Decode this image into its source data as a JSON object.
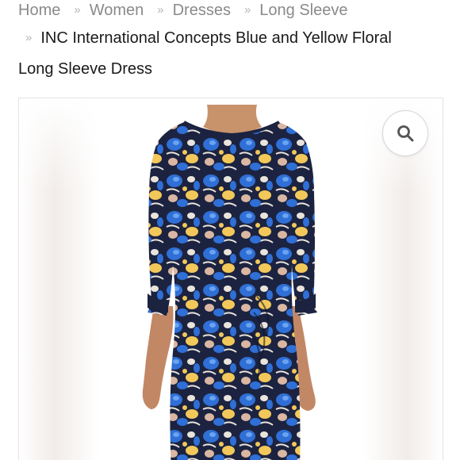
{
  "breadcrumb": {
    "items": [
      {
        "label": "Home"
      },
      {
        "label": "Women"
      },
      {
        "label": "Dresses"
      },
      {
        "label": "Long Sleeve"
      }
    ],
    "separator": "»"
  },
  "product": {
    "title_line1": "INC International Concepts Blue and Yellow Floral",
    "title_line2": "Long Sleeve Dress"
  },
  "gallery": {
    "zoom_icon": "search-icon"
  },
  "colors": {
    "breadcrumb_text": "#8a8a8a",
    "title_text": "#1a1a1a",
    "dress_navy": "#1c2340",
    "dress_blue": "#2f6fd6",
    "dress_yellow": "#f2c85a"
  }
}
